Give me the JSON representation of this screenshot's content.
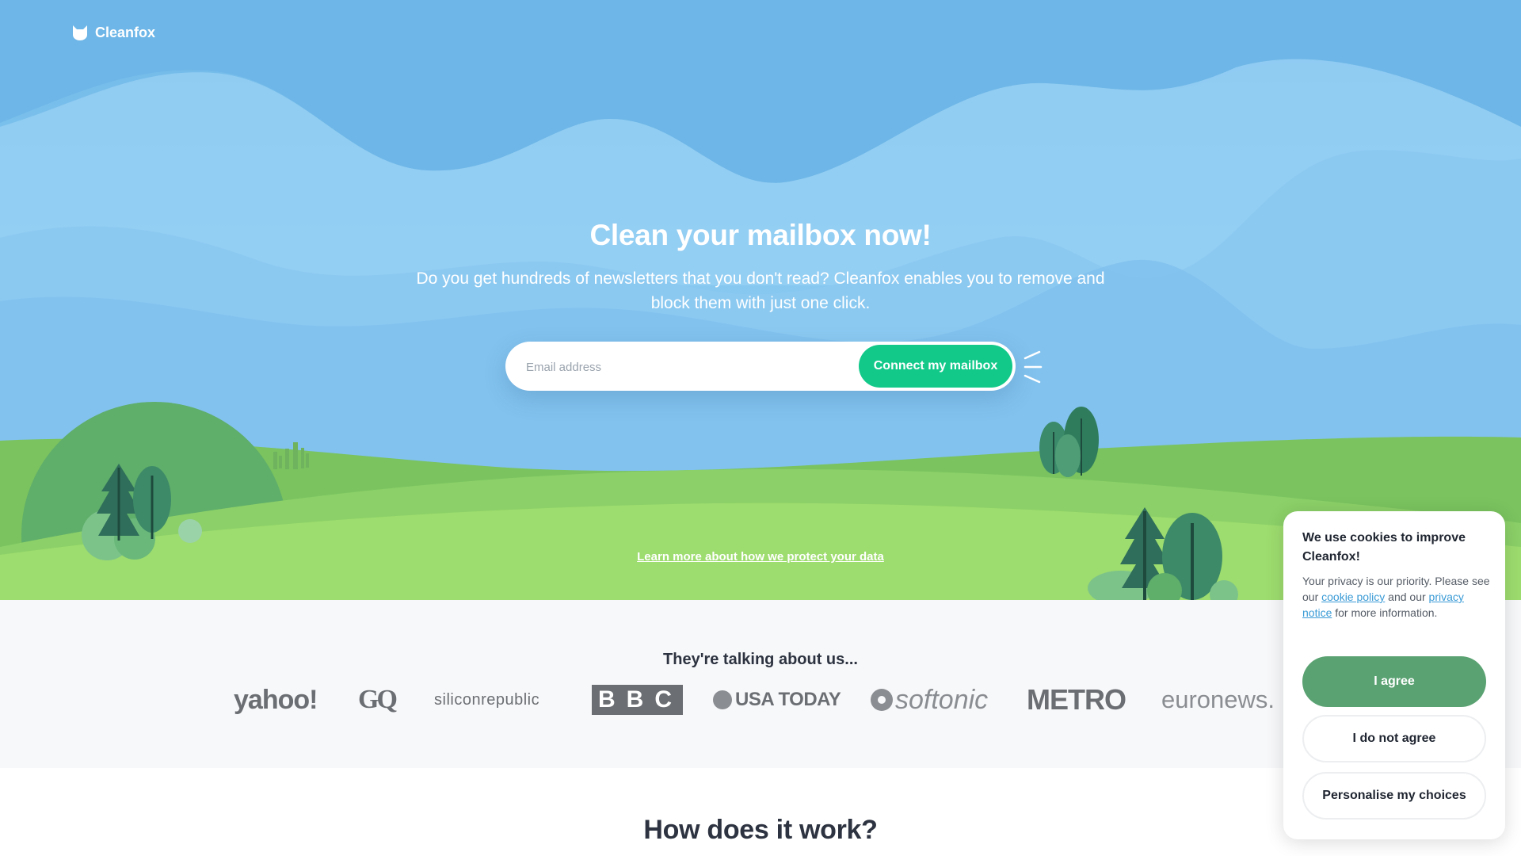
{
  "brand": {
    "name": "Cleanfox",
    "icon": "fox-head-icon"
  },
  "hero": {
    "title": "Clean your mailbox now!",
    "subtitle": "Do you get hundreds of newsletters that you don't read? Cleanfox enables you to remove and block them with just one click.",
    "email_placeholder": "Email address",
    "email_value": "",
    "connect_label": "Connect my mailbox",
    "learn_more_link": "Learn more about how we protect your data"
  },
  "press": {
    "title": "They're talking about us...",
    "logos": [
      "yahoo!",
      "GQ",
      "siliconrepublic",
      "BBC",
      "USA TODAY",
      "softonic",
      "METRO",
      "euronews."
    ]
  },
  "how": {
    "title": "How does it work?"
  },
  "cookie_banner": {
    "title": "We use cookies to improve Cleanfox!",
    "text_before": "Your privacy is our priority. Please see our ",
    "cookie_policy_link": "cookie policy",
    "text_middle": " and our ",
    "privacy_notice_link": "privacy notice",
    "text_after": " for more information.",
    "agree_label": "I agree",
    "disagree_label": "I do not agree",
    "personalise_label": "Personalise my choices"
  },
  "colors": {
    "sky": "#6fb8e8",
    "accent_green": "#12c98a",
    "agree_green": "#5aa272",
    "hill_green": "#8fd46a",
    "link_blue": "#3a9bd6",
    "text_dark": "#2d3340",
    "press_bg": "#f7f8fa"
  }
}
